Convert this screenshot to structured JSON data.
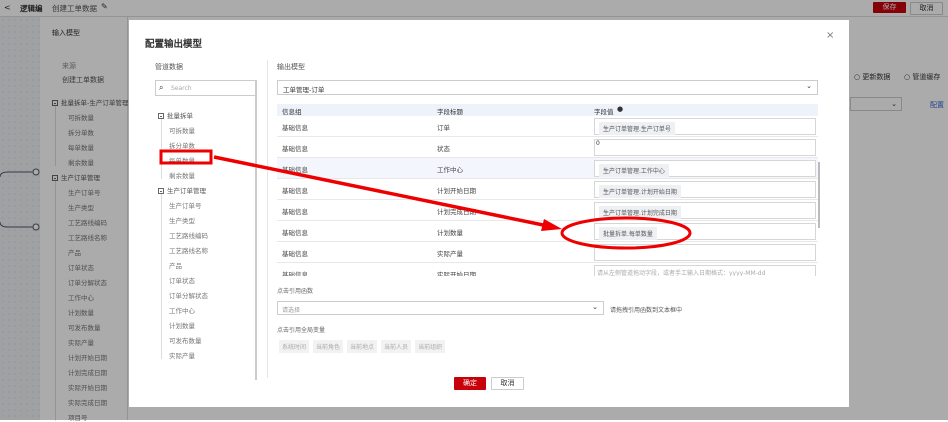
{
  "topbar": {
    "back": "<",
    "crumb": "逻辑编",
    "title": "创建工单数据",
    "save": "保存",
    "cancel": "取消"
  },
  "input_panel": {
    "title": "输入模型",
    "source_label": "来源",
    "source_value": "创建工单数据",
    "groups": [
      {
        "label": "批量拆单-生产订单管理",
        "items": [
          "可拆数量",
          "拆分单数",
          "每单数量",
          "剩余数量"
        ]
      },
      {
        "label": "生产订单管理",
        "items": [
          "生产订单号",
          "生产类型",
          "工艺路线编码",
          "工艺路线名称",
          "产品",
          "订单状态",
          "订单分解状态",
          "工作中心",
          "计划数量",
          "可发布数量",
          "实际产量",
          "计划开始日期",
          "计划完成日期",
          "实际开始日期",
          "实际完成日期",
          "项目号"
        ]
      }
    ]
  },
  "right_bg": {
    "radio1": "更新数据",
    "radio2": "管道缓存",
    "config": "配置"
  },
  "modal": {
    "title": "配置输出模型",
    "close": "×",
    "pipeline": {
      "title": "管道数据",
      "search_placeholder": "Search",
      "groups": [
        {
          "label": "批量拆单",
          "items": [
            "可拆数量",
            "拆分单数",
            "每单数量",
            "剩余数量"
          ]
        },
        {
          "label": "生产订单管理",
          "items": [
            "生产订单号",
            "生产类型",
            "工艺路线编码",
            "工艺路线名称",
            "产品",
            "订单状态",
            "订单分解状态",
            "工作中心",
            "计划数量",
            "可发布数量",
            "实际产量"
          ]
        }
      ]
    },
    "output": {
      "title": "输出模型",
      "model_select": "工单管理-订单",
      "headers": [
        "信息组",
        "字段标题",
        "字段值"
      ],
      "rows": [
        {
          "group": "基础信息",
          "field": "订单",
          "chip": "生产订单管理.生产订单号"
        },
        {
          "group": "基础信息",
          "field": "状态",
          "text": "0"
        },
        {
          "group": "基础信息",
          "field": "工作中心",
          "chip": "生产订单管理.工作中心"
        },
        {
          "group": "基础信息",
          "field": "计划开始日期",
          "chip": "生产订单管理.计划开始日期"
        },
        {
          "group": "基础信息",
          "field": "计划完成日期",
          "chip": "生产订单管理.计划完成日期"
        },
        {
          "group": "基础信息",
          "field": "计划数量",
          "chip": "批量拆单.每单数量"
        },
        {
          "group": "基础信息",
          "field": "实际产量"
        },
        {
          "group": "基础信息",
          "field": "实际开始日期",
          "placeholder": "请从左侧管道拖动字段，或者手工输入日期格式：yyyy-MM-dd"
        }
      ]
    },
    "function": {
      "label": "点击引用函数",
      "placeholder": "请选择",
      "hint": "请拖拽引用函数到文本框中"
    },
    "globals": {
      "label": "点击引用全局变量",
      "items": [
        "系统时间",
        "当前角色",
        "当前地点",
        "当前人员",
        "当前组织"
      ]
    },
    "ok": "确定",
    "cancel": "取消"
  },
  "annotation_color": "#ee0000",
  "accent": "#c7000b"
}
